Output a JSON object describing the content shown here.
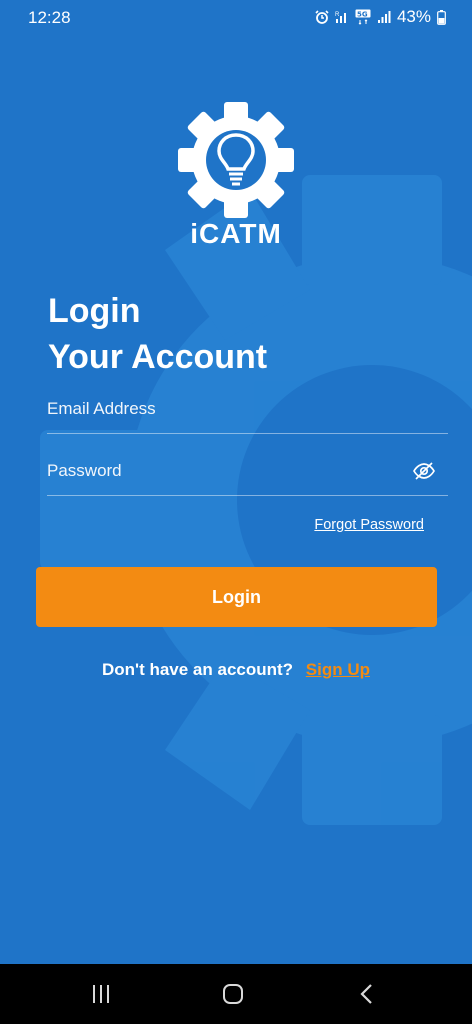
{
  "status_bar": {
    "time": "12:28",
    "battery": "43%"
  },
  "brand": {
    "name": "iCATM"
  },
  "login_form": {
    "title_line1": "Login",
    "title_line2": "Your Account",
    "email_placeholder": "Email Address",
    "email_value": "",
    "password_placeholder": "Password",
    "password_value": "",
    "forgot_label": "Forgot Password",
    "login_label": "Login",
    "signup_prompt": "Don't have an account?",
    "signup_label": "Sign Up"
  },
  "colors": {
    "background": "#1f74c8",
    "accent": "#f38b12",
    "text": "#ffffff"
  },
  "icons": [
    "alarm-icon",
    "signal-icon",
    "5g-icon",
    "battery-icon",
    "eye-off-icon",
    "recents-icon",
    "home-icon",
    "back-icon"
  ]
}
